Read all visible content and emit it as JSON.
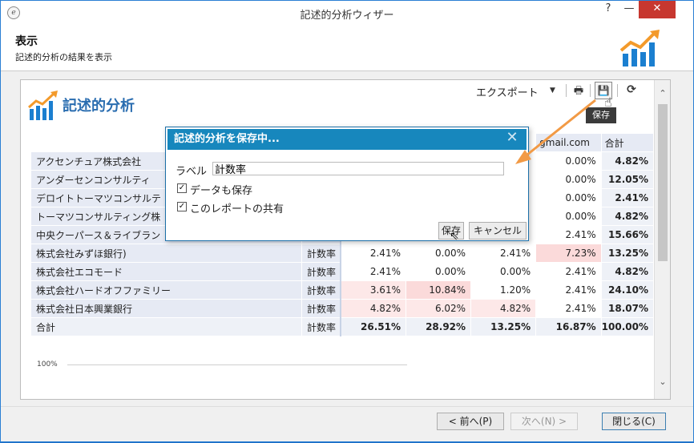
{
  "window": {
    "title": "記述的分析ウィザー",
    "help_glyph": "?",
    "min_glyph": "—",
    "close_glyph": "✕"
  },
  "header": {
    "title": "表示",
    "subtitle": "記述的分析の結果を表示"
  },
  "report": {
    "title": "記述的分析",
    "toolbar": {
      "export_label": "エクスポート",
      "print_glyph": "🖶",
      "save_glyph": "💾",
      "refresh_glyph": "⟳",
      "save_tooltip": "保存"
    },
    "table": {
      "headers": [
        "gmail.com",
        "合計"
      ],
      "rows": [
        {
          "name": "アクセンチュア株式会社",
          "measure": "",
          "v1": "",
          "v2": "",
          "v3": "",
          "v4": "0.00%",
          "total": "4.82%"
        },
        {
          "name": "アンダーセンコンサルティ",
          "measure": "",
          "v1": "",
          "v2": "",
          "v3": "",
          "v4": "0.00%",
          "total": "12.05%"
        },
        {
          "name": "デロイトトーマツコンサルテ",
          "measure": "",
          "v1": "",
          "v2": "",
          "v3": "",
          "v4": "0.00%",
          "total": "2.41%"
        },
        {
          "name": "トーマツコンサルティング株",
          "measure": "",
          "v1": "",
          "v2": "",
          "v3": "",
          "v4": "0.00%",
          "total": "4.82%"
        },
        {
          "name": "中央クーパース＆ライブラン",
          "measure": "",
          "v1": "",
          "v2": "",
          "v3": "",
          "v4": "2.41%",
          "total": "15.66%"
        },
        {
          "name": "株式会社みずほ銀行)",
          "measure": "計数率",
          "v1": "2.41%",
          "v2": "0.00%",
          "v3": "2.41%",
          "v4": "7.23%",
          "total": "13.25%"
        },
        {
          "name": "株式会社エコモード",
          "measure": "計数率",
          "v1": "2.41%",
          "v2": "0.00%",
          "v3": "0.00%",
          "v4": "2.41%",
          "total": "4.82%"
        },
        {
          "name": "株式会社ハードオフファミリー",
          "measure": "計数率",
          "v1": "3.61%",
          "v2": "10.84%",
          "v3": "1.20%",
          "v4": "2.41%",
          "total": "24.10%"
        },
        {
          "name": "株式会社日本興業銀行",
          "measure": "計数率",
          "v1": "4.82%",
          "v2": "6.02%",
          "v3": "4.82%",
          "v4": "2.41%",
          "total": "18.07%"
        }
      ],
      "total_row": {
        "name": "合計",
        "measure": "計数率",
        "v1": "26.51%",
        "v2": "28.92%",
        "v3": "13.25%",
        "v4": "16.87%",
        "total": "100.00%"
      }
    },
    "chart_axis_label": "100%"
  },
  "dialog": {
    "title": "記述的分析を保存中...",
    "close_glyph": "✕",
    "label_text": "ラベル",
    "label_value": "計数率",
    "checkbox1_label": "データも保存",
    "checkbox2_label": "このレポートの共有",
    "checkbox_glyph": "✓",
    "save_button": "保存",
    "cancel_button": "キャンセル"
  },
  "footer": {
    "prev_button": "< 前へ(P)",
    "next_button": "次へ(N) >",
    "close_button": "閉じる(C)"
  },
  "scrollbar": {
    "up_glyph": "⌃",
    "down_glyph": "⌄"
  },
  "colors": {
    "accent_blue": "#1787bd",
    "logo_orange": "#f39a2b",
    "logo_blue": "#1b7fd0",
    "highlight_pink": "#fde8e8",
    "annotation_arrow": "#f29a45"
  }
}
